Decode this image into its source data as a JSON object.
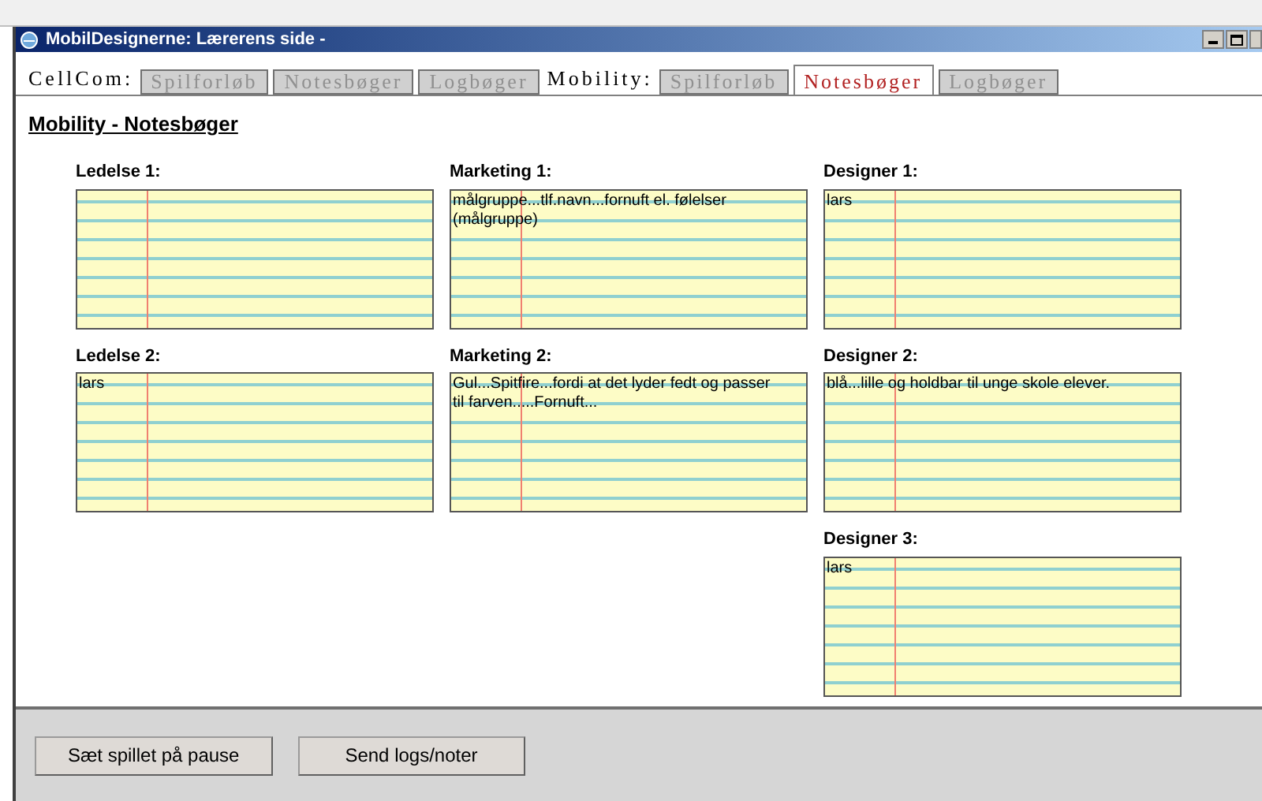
{
  "window": {
    "title": "MobilDesignerne: Lærerens side -"
  },
  "tab_groups": [
    {
      "label": "CellCom:",
      "tabs": [
        {
          "label": "Spilforløb",
          "selected": false
        },
        {
          "label": "Notesbøger",
          "selected": false
        },
        {
          "label": "Logbøger",
          "selected": false
        }
      ]
    },
    {
      "label": "Mobility:",
      "tabs": [
        {
          "label": "Spilforløb",
          "selected": false
        },
        {
          "label": "Notesbøger",
          "selected": true
        },
        {
          "label": "Logbøger",
          "selected": false
        }
      ]
    }
  ],
  "heading": "Mobility - Notesbøger",
  "columns": [
    {
      "notes": [
        {
          "label": "Ledelse 1:"
        },
        {
          "label": "Ledelse 2:",
          "text": "lars"
        }
      ]
    },
    {
      "notes": [
        {
          "label": "Marketing 1:",
          "text": "målgruppe...tlf.navn...fornuft el. følelser (målgruppe)"
        },
        {
          "label": "Marketing 2:",
          "text": "Gul...Spitfire...fordi at det lyder fedt og passer til farven.....Fornuft..."
        }
      ]
    },
    {
      "notes": [
        {
          "label": "Designer 1:",
          "text": "lars"
        },
        {
          "label": "Designer 2:",
          "text": "blå...lille og holdbar til unge skole elever."
        },
        {
          "label": "Designer 3:",
          "text": "lars"
        }
      ]
    }
  ],
  "buttons": [
    "Sæt spillet på pause",
    "Send logs/noter"
  ]
}
